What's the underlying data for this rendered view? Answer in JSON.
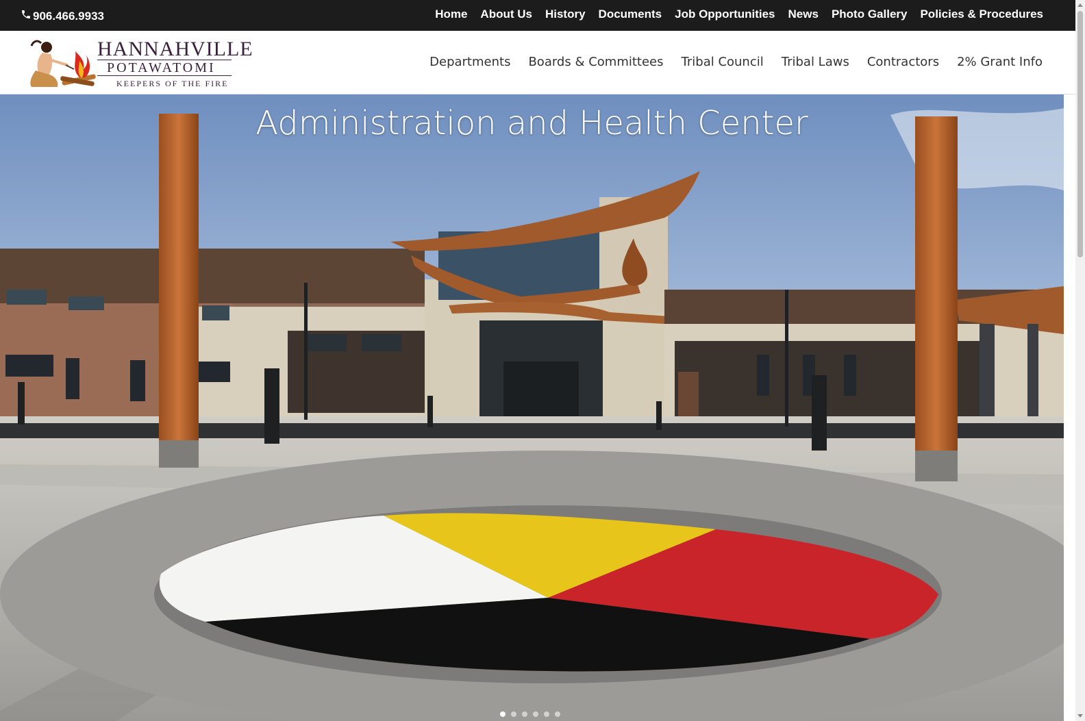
{
  "topbar": {
    "phone": "906.466.9933",
    "phone_icon": "phone-icon",
    "links": [
      "Home",
      "About Us",
      "History",
      "Documents",
      "Job Opportunities",
      "News",
      "Photo Gallery",
      "Policies & Procedures"
    ]
  },
  "logo": {
    "line1": "HANNAHVILLE",
    "line2": "POTAWATOMI",
    "line3": "KEEPERS OF THE FIRE"
  },
  "mainnav": {
    "items": [
      "Departments",
      "Boards & Committees",
      "Tribal Council",
      "Tribal Laws",
      "Contractors",
      "2% Grant Info"
    ]
  },
  "hero": {
    "title": "Administration and Health Center",
    "slide_count": 6,
    "active_slide": 1
  },
  "colors": {
    "topbar_bg": "#1c1c1c",
    "logo_text": "#3a1f3c",
    "medicine_wheel": [
      "#f4f4f2",
      "#e8c51a",
      "#c8242a",
      "#111111"
    ]
  }
}
